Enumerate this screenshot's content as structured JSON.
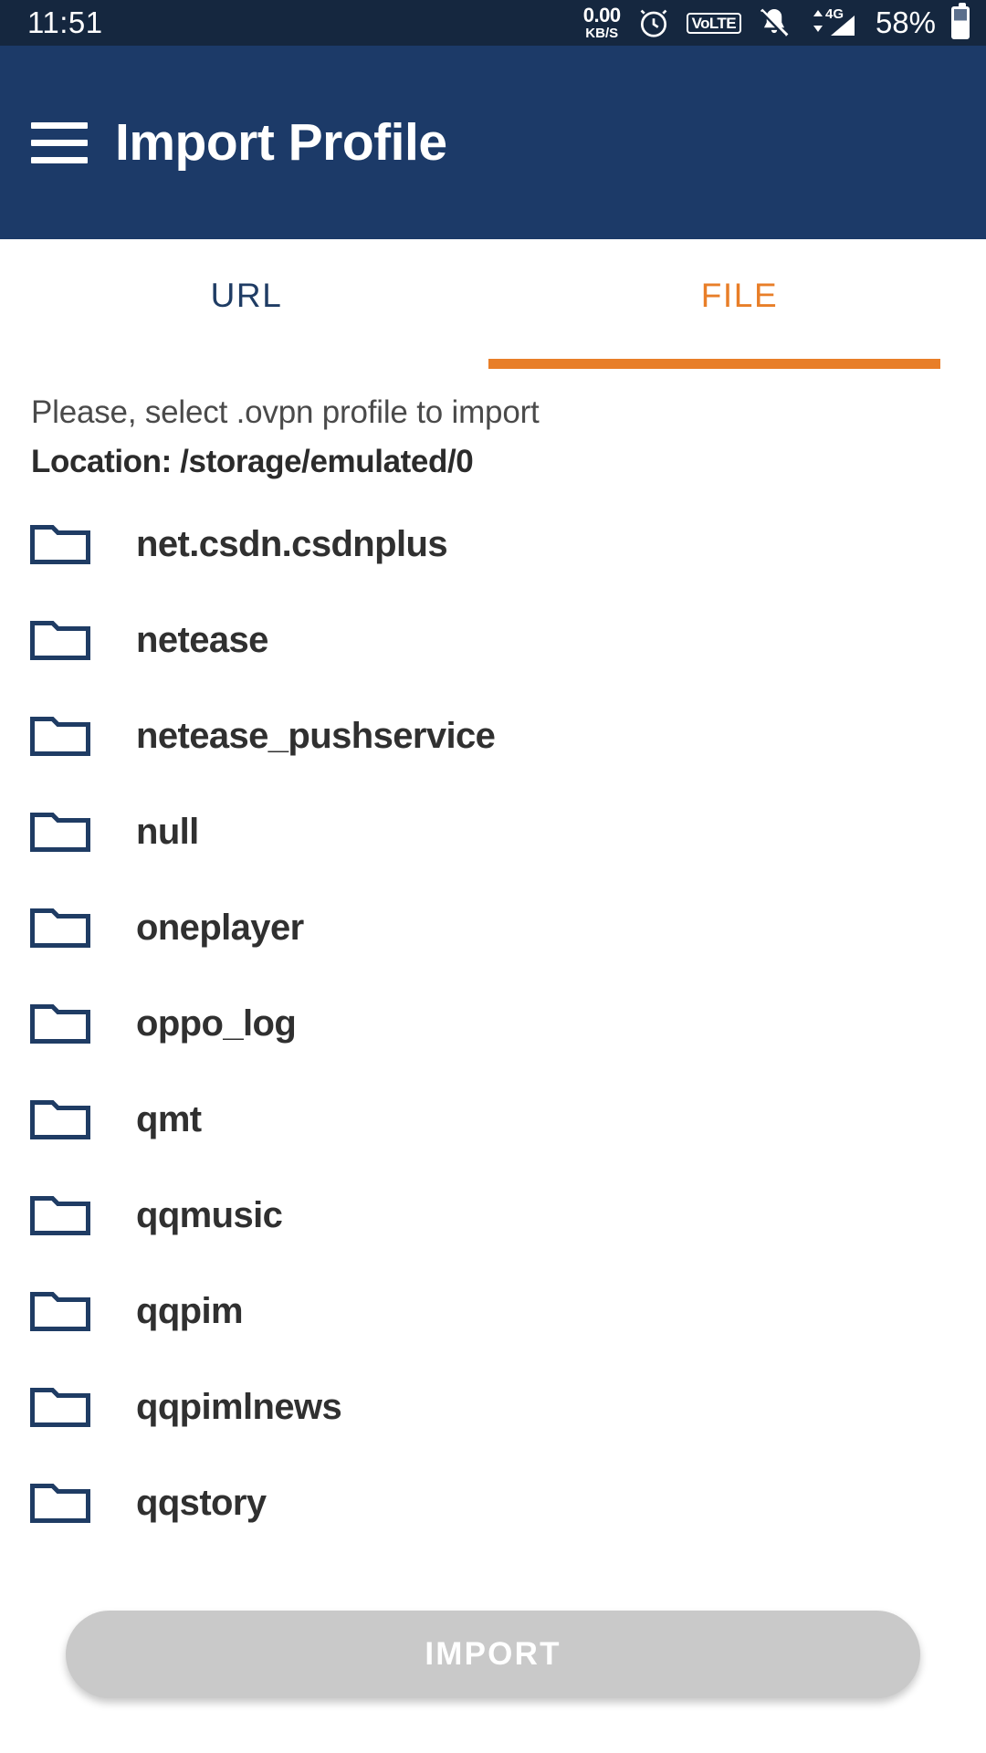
{
  "status_bar": {
    "time": "11:51",
    "data_rate_value": "0.00",
    "data_rate_unit": "KB/S",
    "alarm_icon": "alarm-clock-icon",
    "volte_label": "VoLTE",
    "mute_icon": "bell-muted-icon",
    "network_label": "4G",
    "signal_icon": "signal-bars-icon",
    "battery_percent": "58%",
    "background_color": "#15273f"
  },
  "app_bar": {
    "menu_icon": "hamburger-menu-icon",
    "title": "Import Profile",
    "background_color": "#1c3a68",
    "text_color": "#ffffff"
  },
  "tabs": {
    "items": [
      {
        "label": "URL",
        "active": false,
        "color": "#1f3c64"
      },
      {
        "label": "FILE",
        "active": true,
        "color": "#e87e28"
      }
    ],
    "indicator_color": "#e87e28",
    "active_index": 1
  },
  "instructions": {
    "prompt": "Please, select .ovpn profile to import",
    "location": "Location: /storage/emulated/0"
  },
  "file_list": {
    "icon": "folder-icon",
    "icon_color": "#1f3c64",
    "items": [
      {
        "name": "net.csdn.csdnplus",
        "type": "folder"
      },
      {
        "name": "netease",
        "type": "folder"
      },
      {
        "name": "netease_pushservice",
        "type": "folder"
      },
      {
        "name": "null",
        "type": "folder"
      },
      {
        "name": "oneplayer",
        "type": "folder"
      },
      {
        "name": "oppo_log",
        "type": "folder"
      },
      {
        "name": "qmt",
        "type": "folder"
      },
      {
        "name": "qqmusic",
        "type": "folder"
      },
      {
        "name": "qqpim",
        "type": "folder"
      },
      {
        "name": "qqpimlnews",
        "type": "folder"
      },
      {
        "name": "qqstory",
        "type": "folder"
      }
    ]
  },
  "footer": {
    "import_label": "IMPORT",
    "import_enabled": false,
    "import_background": "#c9c9c9",
    "import_text_color": "#ffffff"
  }
}
